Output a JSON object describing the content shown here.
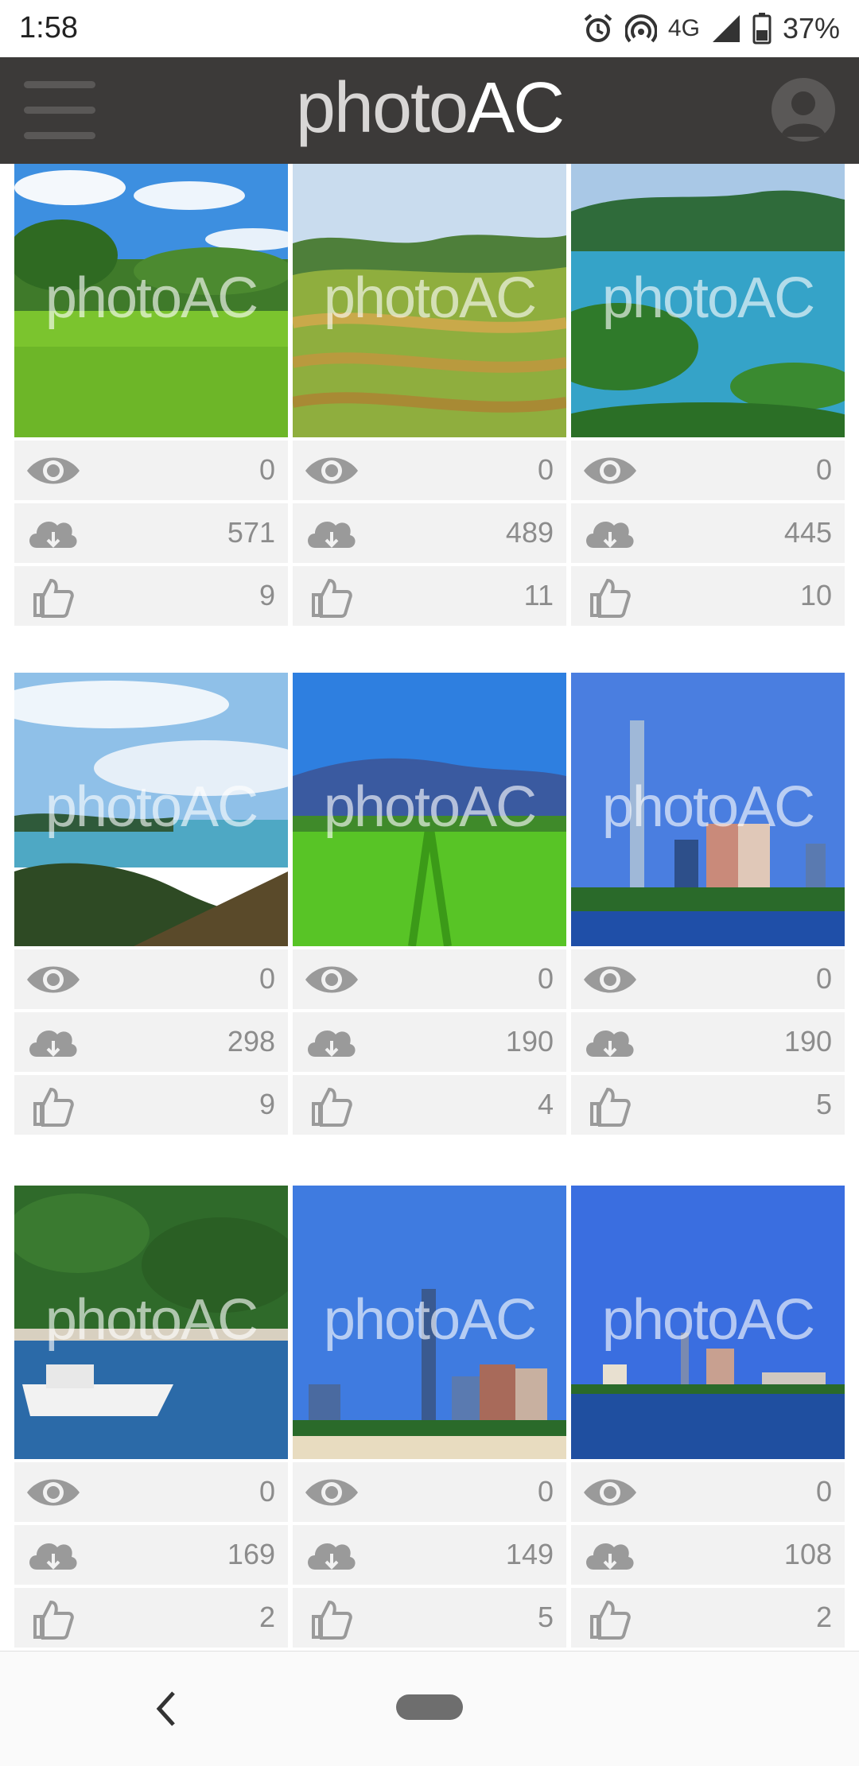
{
  "status_bar": {
    "time": "1:58",
    "network": "4G",
    "battery": "37%",
    "icons": [
      "alarm-icon",
      "hotspot-icon",
      "signal-icon",
      "battery-icon"
    ]
  },
  "header": {
    "logo_part1": "photo",
    "logo_part2": "AC",
    "menu_icon": "hamburger-menu-icon",
    "account_icon": "user-avatar-icon"
  },
  "watermark": "photoAC",
  "stat_icons": {
    "views": "eye-icon",
    "downloads": "cloud-download-icon",
    "likes": "thumbs-up-icon"
  },
  "photos": [
    {
      "subject": "green rice field",
      "views": "0",
      "downloads": "571",
      "likes": "9"
    },
    {
      "subject": "terraced rice fields",
      "views": "0",
      "downloads": "489",
      "likes": "11"
    },
    {
      "subject": "bay islands",
      "views": "0",
      "downloads": "445",
      "likes": "10"
    },
    {
      "subject": "sea view from hill",
      "views": "0",
      "downloads": "298",
      "likes": "9"
    },
    {
      "subject": "field and mountains",
      "views": "0",
      "downloads": "190",
      "likes": "4"
    },
    {
      "subject": "city tower skyline",
      "views": "0",
      "downloads": "190",
      "likes": "5"
    },
    {
      "subject": "fishing boat",
      "views": "0",
      "downloads": "169",
      "likes": "2"
    },
    {
      "subject": "tower skyline beach",
      "views": "0",
      "downloads": "149",
      "likes": "5"
    },
    {
      "subject": "distant skyline",
      "views": "0",
      "downloads": "108",
      "likes": "2"
    }
  ],
  "colors": {
    "header_bg": "#3c3a39",
    "stat_bg": "#f2f2f2",
    "stat_text": "#8c8c8c"
  }
}
